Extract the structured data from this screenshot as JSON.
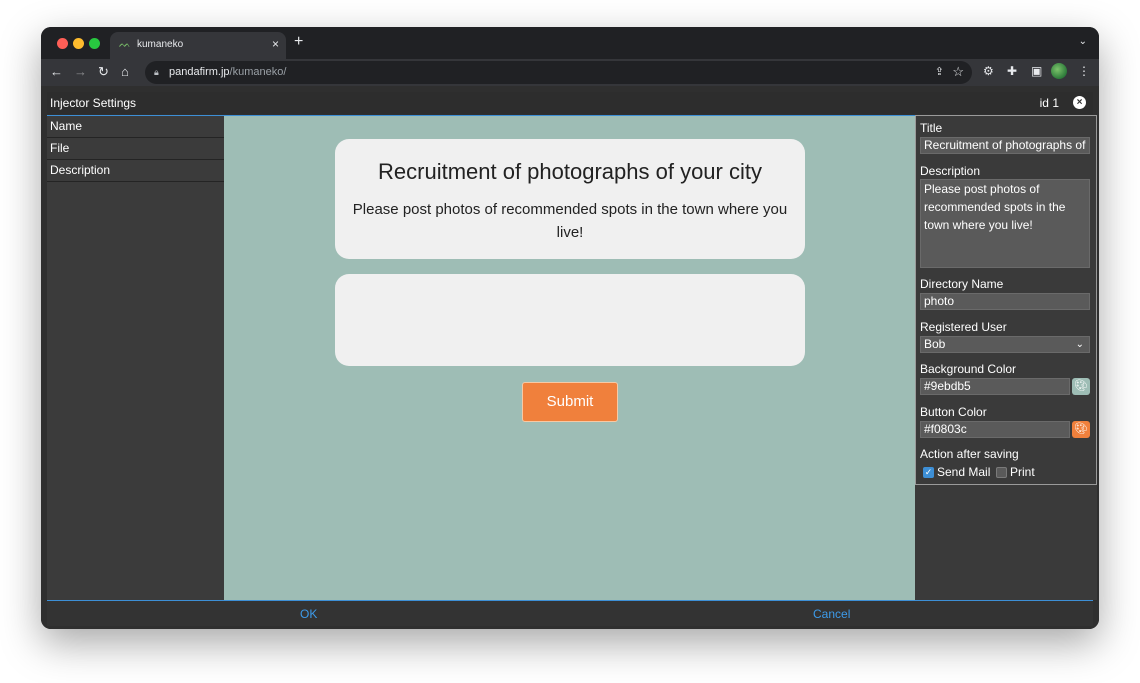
{
  "browser": {
    "tab_title": "kumaneko",
    "tab_close": "×",
    "new_tab": "+",
    "tab_menu": "⌄",
    "url_host": "pandafirm.jp",
    "url_path": "/kumaneko/"
  },
  "app": {
    "title": "Injector Settings",
    "id_label": "id 1",
    "close_icon": "×"
  },
  "left_panel": {
    "items": [
      "Name",
      "File",
      "Description"
    ]
  },
  "preview": {
    "background_color": "#9ebdb5",
    "card_title": "Recruitment of photographs of your city",
    "card_description": "Please post photos of recommended spots in the town where you live!",
    "submit_label": "Submit",
    "button_color": "#f0803c"
  },
  "properties": {
    "title_label": "Title",
    "title_value": "Recruitment of photographs of",
    "description_label": "Description",
    "description_value": "Please post photos of recommended spots in the town where you live!",
    "directory_label": "Directory Name",
    "directory_value": "photo",
    "registered_user_label": "Registered User",
    "registered_user_value": "Bob",
    "background_color_label": "Background Color",
    "background_color_value": "#9ebdb5",
    "button_color_label": "Button Color",
    "button_color_value": "#f0803c",
    "action_label": "Action after saving",
    "send_mail_label": "Send Mail",
    "send_mail_checked": true,
    "print_label": "Print",
    "print_checked": false
  },
  "footer": {
    "ok_label": "OK",
    "cancel_label": "Cancel"
  }
}
